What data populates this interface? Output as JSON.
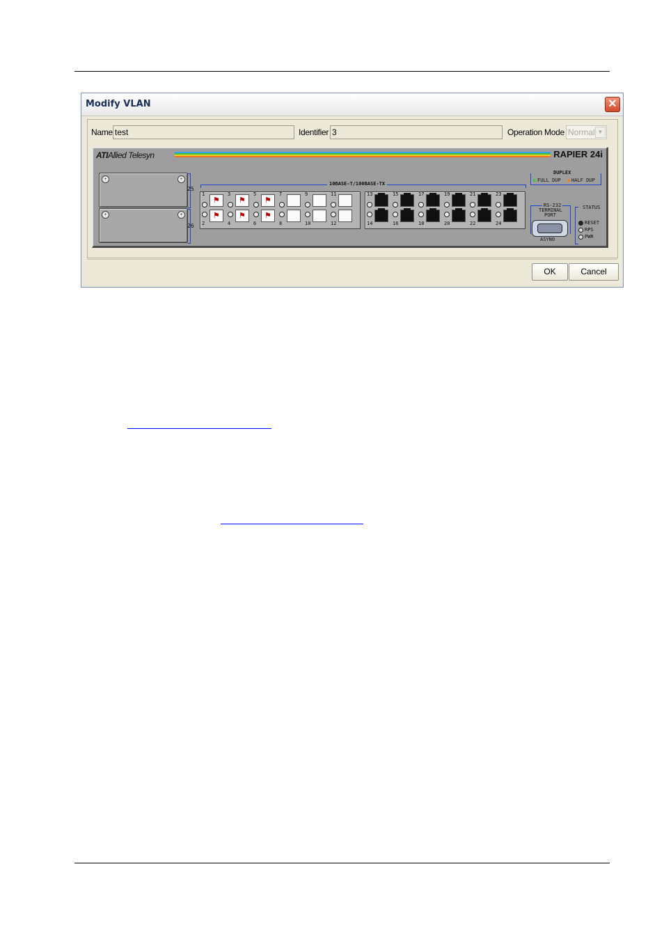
{
  "dialog": {
    "title": "Modify VLAN",
    "close_icon": "close-icon"
  },
  "form": {
    "name_label": "Name",
    "name_value": "test",
    "identifier_label": "Identifier",
    "identifier_value": "3",
    "operation_mode_label": "Operation Mode",
    "operation_mode_value": "Normal"
  },
  "device": {
    "brand": "Allied Telesyn",
    "model": "RAPIER 24i",
    "ports_label": "10BASE-T/100BASE-TX",
    "slot_top_number": "25",
    "slot_bottom_number": "26",
    "duplex_label": "DUPLEX",
    "full_dup_label": "FULL DUP",
    "half_dup_label": "HALF DUP",
    "terminal_label_line1": "RS-232",
    "terminal_label_line2": "TERMINAL",
    "terminal_label_line3": "PORT",
    "terminal_sub": "ASYNO",
    "status_label": "STATUS",
    "status_reset": "RESET",
    "status_rps": "RPS",
    "status_pwr": "PWR",
    "colors": {
      "full_dup_led": "#3cc83c",
      "half_dup_led": "#f08020",
      "flag": "#b00000"
    },
    "ports_top": [
      "1",
      "3",
      "5",
      "7",
      "9",
      "11",
      "13",
      "15",
      "17",
      "19",
      "21",
      "23"
    ],
    "ports_bottom": [
      "2",
      "4",
      "6",
      "8",
      "10",
      "12",
      "14",
      "16",
      "18",
      "20",
      "22",
      "24"
    ],
    "vlan_member_ports": [
      "1",
      "2",
      "3",
      "4",
      "5",
      "6"
    ]
  },
  "buttons": {
    "ok": "OK",
    "cancel": "Cancel"
  }
}
